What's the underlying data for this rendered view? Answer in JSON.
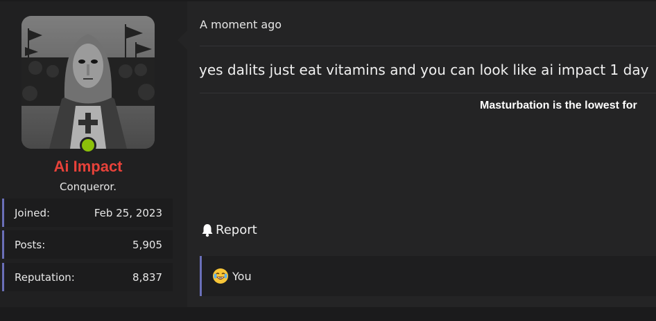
{
  "user": {
    "username": "Ai Impact",
    "user_title": "Conqueror.",
    "online": true,
    "username_color": "#e8423a",
    "stats": [
      {
        "label": "Joined:",
        "value": "Feb 25, 2023"
      },
      {
        "label": "Posts:",
        "value": "5,905"
      },
      {
        "label": "Reputation:",
        "value": "8,837"
      }
    ]
  },
  "post": {
    "timestamp": "A moment ago",
    "message": "yes dalits just eat vitamins and you can look like ai impact 1 day",
    "signature": "Masturbation is the lowest for",
    "report_label": "Report",
    "reactions": {
      "emoji": "crying-laughing-emoji",
      "who": "You"
    }
  },
  "colors": {
    "accent": "#6a6fb8",
    "online": "#8cc00a",
    "background": "#242425"
  }
}
